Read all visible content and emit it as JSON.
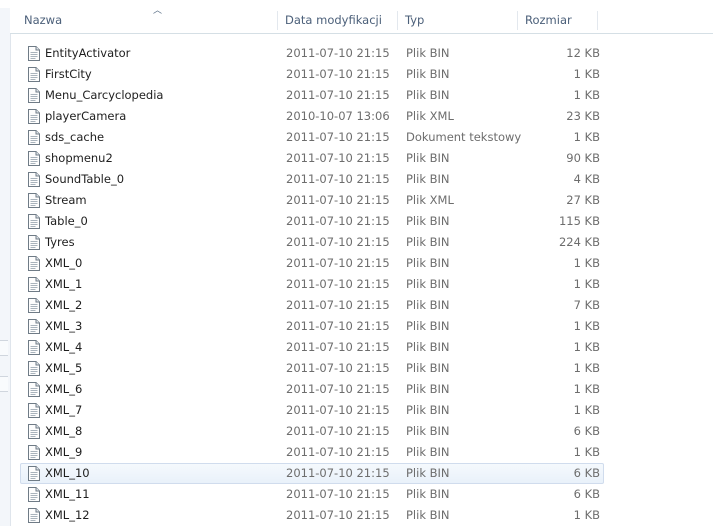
{
  "columns": {
    "name": "Nazwa",
    "date": "Data modyfikacji",
    "type": "Typ",
    "size": "Rozmiar"
  },
  "icons": {
    "file": "document-icon",
    "sort": "sort-up-arrow-icon"
  },
  "files": [
    {
      "name": "EntityActivator",
      "date": "2011-07-10 21:15",
      "type": "Plik BIN",
      "size": "12 KB"
    },
    {
      "name": "FirstCity",
      "date": "2011-07-10 21:15",
      "type": "Plik BIN",
      "size": "1 KB"
    },
    {
      "name": "Menu_Carcyclopedia",
      "date": "2011-07-10 21:15",
      "type": "Plik BIN",
      "size": "1 KB"
    },
    {
      "name": "playerCamera",
      "date": "2010-10-07 13:06",
      "type": "Plik XML",
      "size": "23 KB"
    },
    {
      "name": "sds_cache",
      "date": "2011-07-10 21:15",
      "type": "Dokument tekstowy",
      "size": "1 KB"
    },
    {
      "name": "shopmenu2",
      "date": "2011-07-10 21:15",
      "type": "Plik BIN",
      "size": "90 KB"
    },
    {
      "name": "SoundTable_0",
      "date": "2011-07-10 21:15",
      "type": "Plik BIN",
      "size": "4 KB"
    },
    {
      "name": "Stream",
      "date": "2011-07-10 21:15",
      "type": "Plik XML",
      "size": "27 KB"
    },
    {
      "name": "Table_0",
      "date": "2011-07-10 21:15",
      "type": "Plik BIN",
      "size": "115 KB"
    },
    {
      "name": "Tyres",
      "date": "2011-07-10 21:15",
      "type": "Plik BIN",
      "size": "224 KB"
    },
    {
      "name": "XML_0",
      "date": "2011-07-10 21:15",
      "type": "Plik BIN",
      "size": "1 KB"
    },
    {
      "name": "XML_1",
      "date": "2011-07-10 21:15",
      "type": "Plik BIN",
      "size": "1 KB"
    },
    {
      "name": "XML_2",
      "date": "2011-07-10 21:15",
      "type": "Plik BIN",
      "size": "7 KB"
    },
    {
      "name": "XML_3",
      "date": "2011-07-10 21:15",
      "type": "Plik BIN",
      "size": "1 KB"
    },
    {
      "name": "XML_4",
      "date": "2011-07-10 21:15",
      "type": "Plik BIN",
      "size": "1 KB"
    },
    {
      "name": "XML_5",
      "date": "2011-07-10 21:15",
      "type": "Plik BIN",
      "size": "1 KB"
    },
    {
      "name": "XML_6",
      "date": "2011-07-10 21:15",
      "type": "Plik BIN",
      "size": "1 KB"
    },
    {
      "name": "XML_7",
      "date": "2011-07-10 21:15",
      "type": "Plik BIN",
      "size": "1 KB"
    },
    {
      "name": "XML_8",
      "date": "2011-07-10 21:15",
      "type": "Plik BIN",
      "size": "6 KB"
    },
    {
      "name": "XML_9",
      "date": "2011-07-10 21:15",
      "type": "Plik BIN",
      "size": "1 KB"
    },
    {
      "name": "XML_10",
      "date": "2011-07-10 21:15",
      "type": "Plik BIN",
      "size": "6 KB",
      "hover": true
    },
    {
      "name": "XML_11",
      "date": "2011-07-10 21:15",
      "type": "Plik BIN",
      "size": "6 KB"
    },
    {
      "name": "XML_12",
      "date": "2011-07-10 21:15",
      "type": "Plik BIN",
      "size": "1 KB"
    }
  ]
}
